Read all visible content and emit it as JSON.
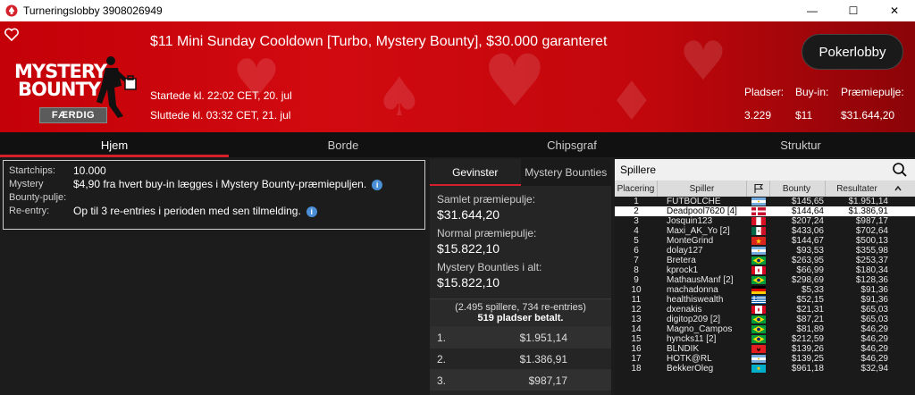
{
  "window": {
    "title": "Turneringslobby 3908026949",
    "minimize": "—",
    "maximize": "☐",
    "close": "✕"
  },
  "header": {
    "logo_word1": "MYSTERY",
    "logo_word2": "BOUNTY",
    "status": "FÆRDIG",
    "title": "$11 Mini Sunday Cooldown [Turbo, Mystery Bounty], $30.000 garanteret",
    "start": "Startede kl. 22:02 CET, 20. jul",
    "end": "Sluttede kl. 03:32 CET, 21. jul",
    "lobby_button": "Pokerlobby",
    "stats": {
      "seats_label": "Pladser:",
      "seats_value": "3.229",
      "buyin_label": "Buy-in:",
      "buyin_value": "$11",
      "pool_label": "Præmiepulje:",
      "pool_value": "$31.644,20"
    }
  },
  "tabs": [
    "Hjem",
    "Borde",
    "Chipsgraf",
    "Struktur"
  ],
  "info": {
    "startchips_label": "Startchips:",
    "startchips_value": "10.000",
    "mystery_label1": "Mystery",
    "mystery_label2": "Bounty-pulje:",
    "mystery_value": "$4,90 fra hvert buy-in lægges i Mystery Bounty-præmiepuljen.",
    "reentry_label": "Re-entry:",
    "reentry_value": "Op til 3 re-entries i perioden med sen tilmelding."
  },
  "prize": {
    "tab_winners": "Gevinster",
    "tab_bounties": "Mystery Bounties",
    "total_label": "Samlet præmiepulje:",
    "total_value": "$31.644,20",
    "normal_label": "Normal præmiepulje:",
    "normal_value": "$15.822,10",
    "mystery_label": "Mystery Bounties i alt:",
    "mystery_value": "$15.822,10",
    "summary1": "(2.495 spillere, 734 re-entries)",
    "summary2": "519 pladser betalt.",
    "payouts": [
      {
        "pos": "1.",
        "amount": "$1.951,14"
      },
      {
        "pos": "2.",
        "amount": "$1.386,91"
      },
      {
        "pos": "3.",
        "amount": "$987,17"
      }
    ]
  },
  "players": {
    "title": "Spillere",
    "columns": {
      "place": "Placering",
      "player": "Spiller",
      "bounty": "Bounty",
      "result": "Resultater"
    },
    "rows": [
      {
        "place": "1",
        "name": "FUTBOLCHE",
        "flag": "argentina",
        "bounty": "$145,65",
        "result": "$1.951,14"
      },
      {
        "place": "2",
        "name": "Deadpool7620 [4]",
        "flag": "denmark",
        "bounty": "$144,64",
        "result": "$1.386,91"
      },
      {
        "place": "3",
        "name": "Josquin123",
        "flag": "peru",
        "bounty": "$207,24",
        "result": "$987,17"
      },
      {
        "place": "4",
        "name": "Maxi_AK_Yo [2]",
        "flag": "mexico",
        "bounty": "$433,06",
        "result": "$702,64"
      },
      {
        "place": "5",
        "name": "MonteGrind",
        "flag": "vietnam",
        "bounty": "$144,67",
        "result": "$500,13"
      },
      {
        "place": "6",
        "name": "dolay127",
        "flag": "argentina",
        "bounty": "$93,53",
        "result": "$355,98"
      },
      {
        "place": "7",
        "name": "Bretera",
        "flag": "brazil",
        "bounty": "$263,95",
        "result": "$253,37"
      },
      {
        "place": "8",
        "name": "kprock1",
        "flag": "canada",
        "bounty": "$66,99",
        "result": "$180,34"
      },
      {
        "place": "9",
        "name": "MathausManf [2]",
        "flag": "brazil",
        "bounty": "$298,69",
        "result": "$128,36"
      },
      {
        "place": "10",
        "name": "machadonna",
        "flag": "germany",
        "bounty": "$5,33",
        "result": "$91,36"
      },
      {
        "place": "11",
        "name": "healthiswealth",
        "flag": "greece",
        "bounty": "$52,15",
        "result": "$91,36"
      },
      {
        "place": "12",
        "name": "dxenakis",
        "flag": "canada",
        "bounty": "$21,31",
        "result": "$65,03"
      },
      {
        "place": "13",
        "name": "digitop209 [2]",
        "flag": "brazil",
        "bounty": "$87,21",
        "result": "$65,03"
      },
      {
        "place": "14",
        "name": "Magno_Campos",
        "flag": "brazil",
        "bounty": "$81,89",
        "result": "$46,29"
      },
      {
        "place": "15",
        "name": "hyncks11 [2]",
        "flag": "brazil",
        "bounty": "$212,59",
        "result": "$46,29"
      },
      {
        "place": "16",
        "name": "BLNDIK",
        "flag": "albania",
        "bounty": "$139,26",
        "result": "$46,29"
      },
      {
        "place": "17",
        "name": "HOTK@RL",
        "flag": "argentina",
        "bounty": "$139,25",
        "result": "$46,29"
      },
      {
        "place": "18",
        "name": "BekkerOleg",
        "flag": "kazakhstan",
        "bounty": "$961,18",
        "result": "$32,94"
      }
    ]
  },
  "colors": {
    "accent": "#d4202a",
    "banner": "#c40008",
    "info_icon": "#4a8fd6"
  }
}
